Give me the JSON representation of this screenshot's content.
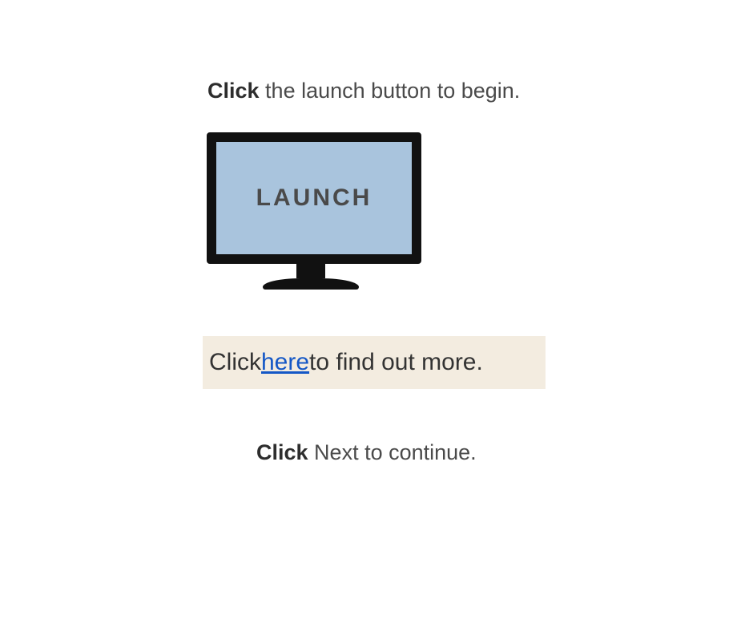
{
  "line1": {
    "bold": "Click",
    "rest": " the launch button to begin."
  },
  "monitor": {
    "button_label": "LAUNCH"
  },
  "highlight": {
    "pre": "Click ",
    "link": "here",
    "post": " to find out more."
  },
  "line3": {
    "bold": "Click",
    "rest": " Next to continue."
  }
}
